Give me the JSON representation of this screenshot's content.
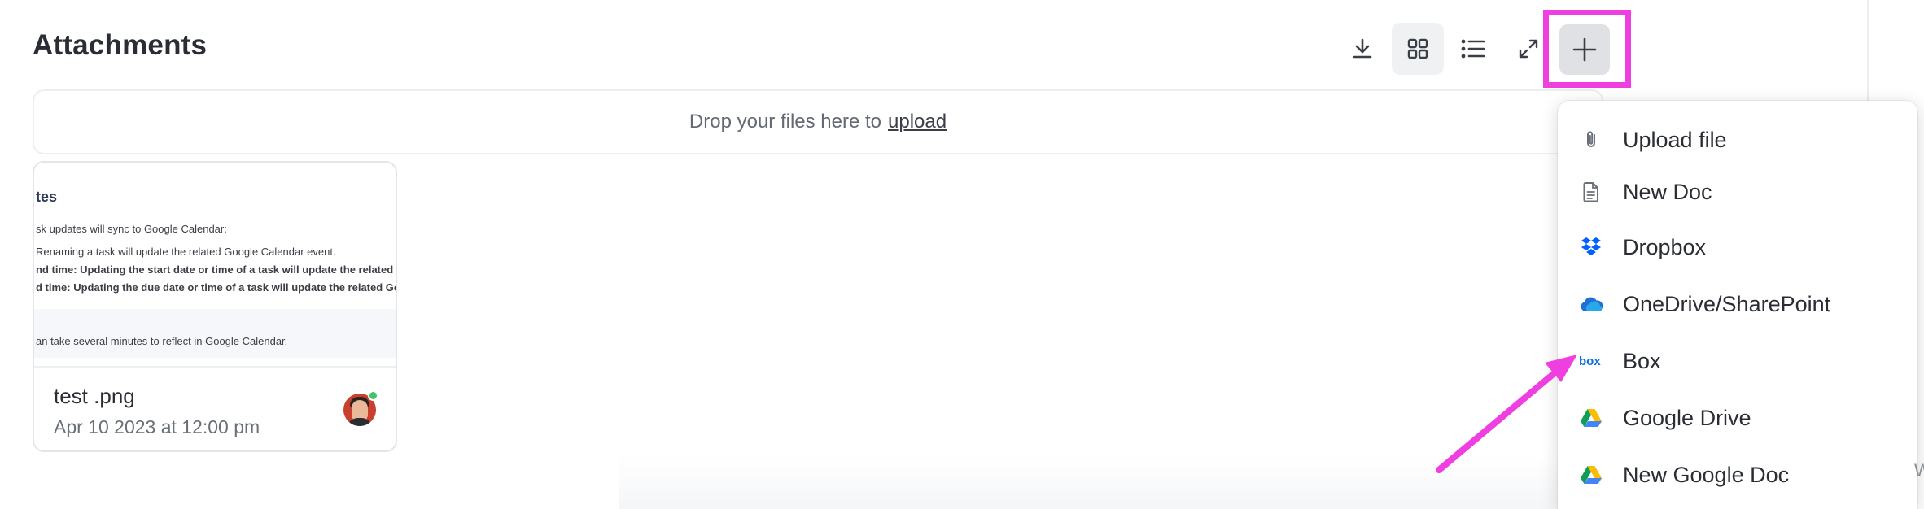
{
  "header": {
    "title": "Attachments"
  },
  "toolbar": {
    "buttons": [
      {
        "icon": "download-icon"
      },
      {
        "icon": "grid-view-icon"
      },
      {
        "icon": "list-view-icon"
      },
      {
        "icon": "expand-icon"
      },
      {
        "icon": "plus-icon"
      }
    ]
  },
  "dropzone": {
    "text": "Drop your files here to",
    "link": "upload"
  },
  "attachment": {
    "preview": {
      "heading": "tes",
      "lines": [
        "sk updates will sync to Google Calendar:",
        "Renaming a task will update the related Google Calendar event.",
        "nd time: Updating the start date or time of a task will update the related Goog",
        "d time: Updating the due date or time of a task will update the related Google",
        "an take several minutes to reflect in Google Calendar."
      ]
    },
    "filename": "test .png",
    "date": "Apr 10 2023 at 12:00 pm"
  },
  "menu": {
    "items": [
      {
        "label": "Upload file",
        "icon": "paperclip-icon"
      },
      {
        "label": "New Doc",
        "icon": "document-icon"
      },
      {
        "label": "Dropbox",
        "icon": "dropbox-icon"
      },
      {
        "label": "OneDrive/SharePoint",
        "icon": "onedrive-icon"
      },
      {
        "label": "Box",
        "icon": "box-icon"
      },
      {
        "label": "Google Drive",
        "icon": "google-drive-icon"
      },
      {
        "label": "New Google Doc",
        "icon": "google-drive-icon"
      }
    ]
  },
  "edge": {
    "text": "W"
  },
  "colors": {
    "highlight": "#ef3fe0",
    "arrow": "#ef3fe0",
    "dropbox": "#0061fe",
    "onedrive": "#1f6fd6",
    "box": "#0b6fe4",
    "online": "#3ec46d"
  }
}
